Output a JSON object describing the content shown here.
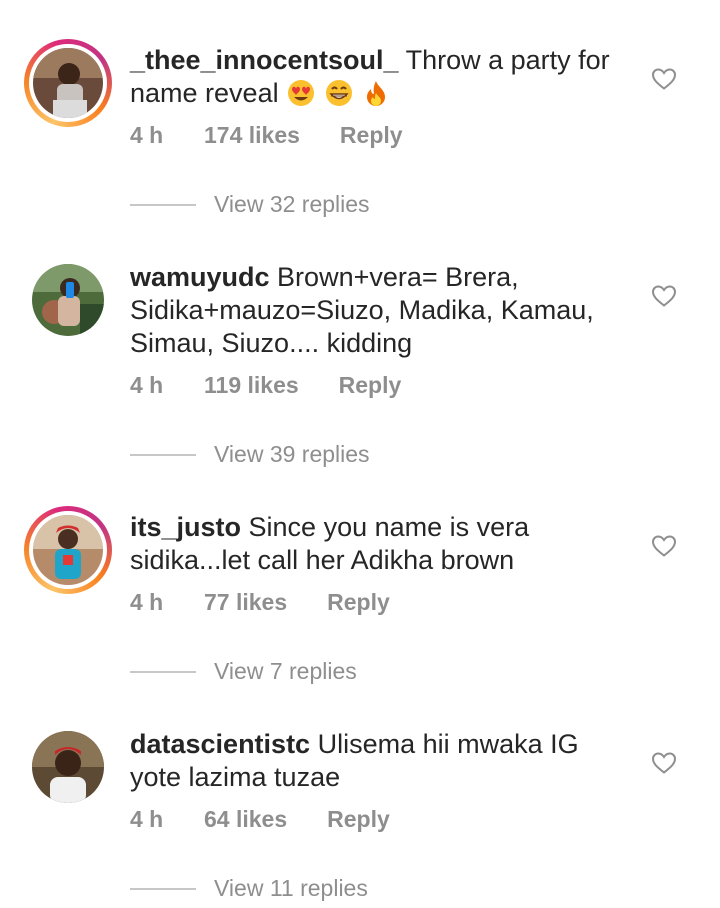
{
  "comments": [
    {
      "username": "_thee_innocentsoul_",
      "text": " Throw a party for name reveal",
      "emojis": [
        "heart-eyes-emoji",
        "grinning-emoji",
        "fire-emoji"
      ],
      "time": "4 h",
      "likes": "174 likes",
      "reply": "Reply",
      "view_replies": "View 32 replies",
      "has_story": true
    },
    {
      "username": "wamuyudc",
      "text": " Brown+vera= Brera, Sidika+mauzo=Siuzo, Madika, Kamau, Simau, Siuzo.... kidding",
      "time": "4 h",
      "likes": "119 likes",
      "reply": "Reply",
      "view_replies": "View 39 replies",
      "has_story": false
    },
    {
      "username": "its_justo",
      "text": " Since you name is vera sidika...let call her Adikha brown",
      "time": "4 h",
      "likes": "77 likes",
      "reply": "Reply",
      "view_replies": "View 7 replies",
      "has_story": true
    },
    {
      "username": "datascientistc",
      "text": " Ulisema hii mwaka IG yote lazima tuzae",
      "time": "4 h",
      "likes": "64 likes",
      "reply": "Reply",
      "view_replies": "View 11 replies",
      "has_story": false
    }
  ],
  "colors": {
    "text": "#262626",
    "secondary": "#8e8e8e",
    "divider": "#c7c7c7"
  }
}
